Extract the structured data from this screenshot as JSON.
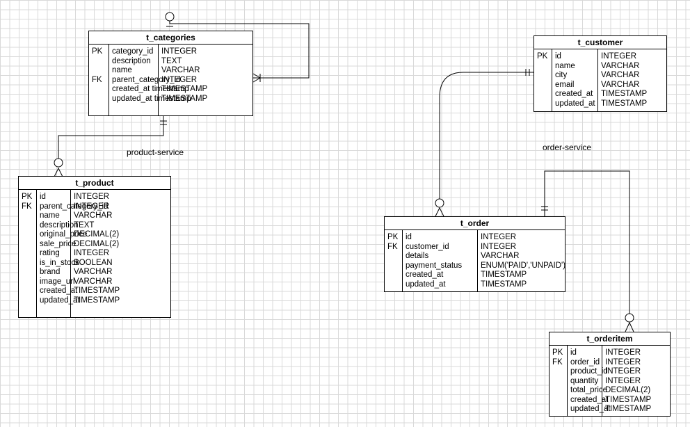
{
  "tables": {
    "categories": {
      "name": "t_categories",
      "rows": [
        {
          "key": "PK",
          "col": "category_id",
          "type": "INTEGER"
        },
        {
          "key": "",
          "col": "description",
          "type": "TEXT"
        },
        {
          "key": "",
          "col": "name",
          "type": "VARCHAR"
        },
        {
          "key": "FK",
          "col": "parent_category_id",
          "type": "INTEGER"
        },
        {
          "key": "",
          "col": "created_at timestamp",
          "type": "TIMESTAMP"
        },
        {
          "key": "",
          "col": "updated_at timestamp",
          "type": "TIMESTAMP"
        }
      ]
    },
    "product": {
      "name": "t_product",
      "rows": [
        {
          "key": "PK",
          "col": "id",
          "type": "INTEGER"
        },
        {
          "key": "FK",
          "col": "parent_category_id",
          "type": "INTEGER"
        },
        {
          "key": "",
          "col": "name",
          "type": "VARCHAR"
        },
        {
          "key": "",
          "col": "description",
          "type": "TEXT"
        },
        {
          "key": "",
          "col": "original_price",
          "type": "DECIMAL(2)"
        },
        {
          "key": "",
          "col": "sale_price",
          "type": "DECIMAL(2)"
        },
        {
          "key": "",
          "col": "rating",
          "type": "INTEGER"
        },
        {
          "key": "",
          "col": "is_in_stock",
          "type": "BOOLEAN"
        },
        {
          "key": "",
          "col": "brand",
          "type": "VARCHAR"
        },
        {
          "key": "",
          "col": "image_url",
          "type": "VARCHAR"
        },
        {
          "key": "",
          "col": "created_at",
          "type": "TIMESTAMP"
        },
        {
          "key": "",
          "col": "updated_at",
          "type": "TIMESTAMP"
        }
      ]
    },
    "customer": {
      "name": "t_customer",
      "rows": [
        {
          "key": "PK",
          "col": "id",
          "type": "INTEGER"
        },
        {
          "key": "",
          "col": "name",
          "type": "VARCHAR"
        },
        {
          "key": "",
          "col": "city",
          "type": "VARCHAR"
        },
        {
          "key": "",
          "col": "email",
          "type": "VARCHAR"
        },
        {
          "key": "",
          "col": "created_at",
          "type": "TIMESTAMP"
        },
        {
          "key": "",
          "col": "updated_at",
          "type": "TIMESTAMP"
        }
      ]
    },
    "order": {
      "name": "t_order",
      "rows": [
        {
          "key": "PK",
          "col": "id",
          "type": "INTEGER"
        },
        {
          "key": "FK",
          "col": "customer_id",
          "type": "INTEGER"
        },
        {
          "key": "",
          "col": "details",
          "type": "VARCHAR"
        },
        {
          "key": "",
          "col": "payment_status",
          "type": "ENUM('PAID','UNPAID')"
        },
        {
          "key": "",
          "col": "created_at",
          "type": "TIMESTAMP"
        },
        {
          "key": "",
          "col": "updated_at",
          "type": "TIMESTAMP"
        }
      ]
    },
    "orderitem": {
      "name": "t_orderitem",
      "rows": [
        {
          "key": "PK",
          "col": "id",
          "type": "INTEGER"
        },
        {
          "key": "FK",
          "col": "order_id",
          "type": "INTEGER"
        },
        {
          "key": "",
          "col": "product_id",
          "type": "INTEGER"
        },
        {
          "key": "",
          "col": "quantity",
          "type": "INTEGER"
        },
        {
          "key": "",
          "col": "total_price",
          "type": "DECIMAL(2)"
        },
        {
          "key": "",
          "col": "created_at",
          "type": "TIMESTAMP"
        },
        {
          "key": "",
          "col": "updated_at",
          "type": "TIMESTAMP"
        }
      ]
    }
  },
  "labels": {
    "product_service": "product-service",
    "order_service": "order-service"
  }
}
